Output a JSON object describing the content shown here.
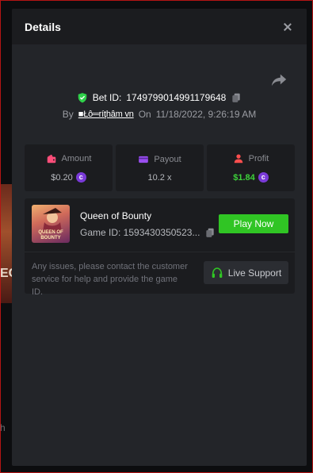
{
  "background": {
    "card_text": "EC",
    "fragment_text": "h"
  },
  "modal": {
    "title": "Details"
  },
  "bet": {
    "label": "Bet ID:",
    "id": "1749799014991179648",
    "by_label": "By",
    "user": "■Łô═ríţhâm vn",
    "on_label": "On",
    "datetime": "11/18/2022, 9:26:19 AM"
  },
  "stats": [
    {
      "label": "Amount",
      "value": "$0.20",
      "icon": "wallet-icon",
      "coin": true,
      "color": "#ff4e7a"
    },
    {
      "label": "Payout",
      "value": "10.2 x",
      "icon": "card-icon",
      "coin": false,
      "color": "#9a4ef0"
    },
    {
      "label": "Profit",
      "value": "$1.84",
      "icon": "user-profit-icon",
      "coin": true,
      "color": "#ff4e4e"
    }
  ],
  "game": {
    "name": "Queen of Bounty",
    "id_text": "Game ID: 1593430350523...",
    "thumb_text": "QUEEN OF BOUNTY",
    "play_label": "Play Now",
    "support_text": "Any issues, please contact the customer service for help and provide the game ID.",
    "live_label": "Live Support"
  },
  "colors": {
    "accent_green": "#30c524",
    "profit_green": "#3dd13a",
    "coin_purple": "#7a3ad8"
  }
}
